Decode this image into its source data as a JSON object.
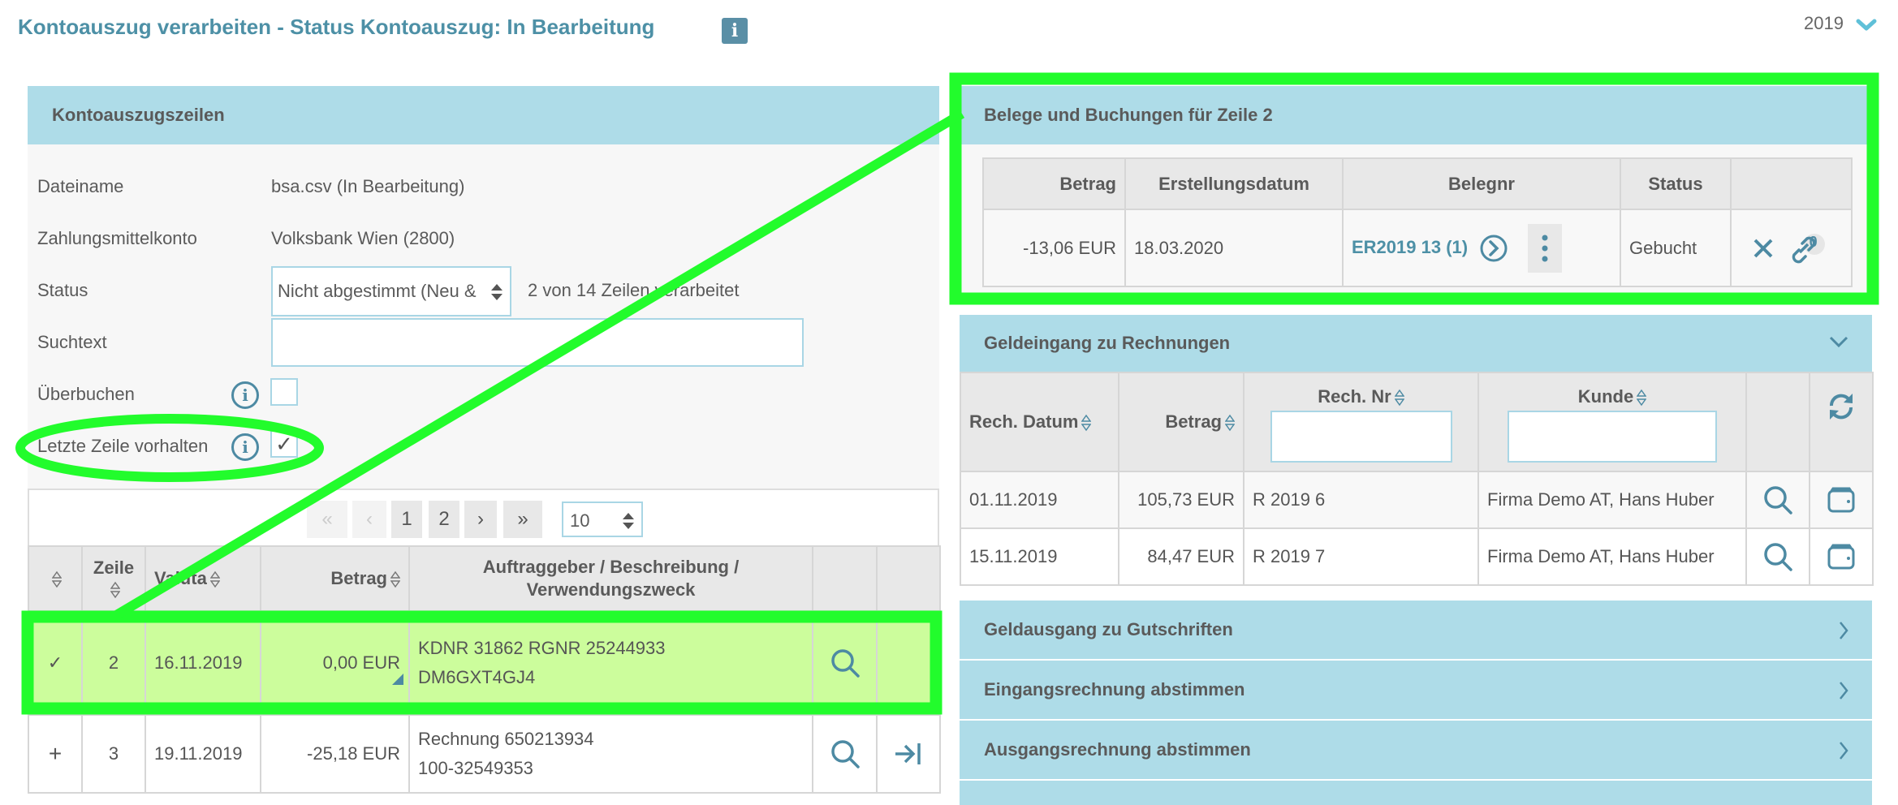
{
  "header": {
    "title": "Kontoauszug verarbeiten - Status Kontoauszug: In Bearbeitung",
    "info_icon_glyph": "i",
    "year": "2019"
  },
  "left_panel": {
    "title": "Kontoauszugszeilen",
    "form": {
      "dateiname_label": "Dateiname",
      "dateiname_value": "bsa.csv (In Bearbeitung)",
      "konto_label": "Zahlungsmittelkonto",
      "konto_value": "Volksbank Wien (2800)",
      "status_label": "Status",
      "status_selected": "Nicht abgestimmt (Neu &",
      "status_progress": "2 von 14 Zeilen verarbeitet",
      "suchtext_label": "Suchtext",
      "suchtext_value": "",
      "ueberbuchen_label": "Überbuchen",
      "ueberbuchen_checked": false,
      "letzte_zeile_label": "Letzte Zeile vorhalten",
      "letzte_zeile_checked": true,
      "check_glyph": "✓"
    },
    "pagination": {
      "first": "«",
      "prev": "‹",
      "pages": [
        "1",
        "2"
      ],
      "next": "›",
      "last": "»",
      "page_size": "10"
    },
    "table": {
      "columns": [
        "",
        "Zeile",
        "Valuta",
        "Betrag",
        "Auftraggeber / Beschreibung / Verwendungszweck",
        "",
        ""
      ],
      "rows": [
        {
          "marker": "✓",
          "zeile": "2",
          "valuta": "16.11.2019",
          "betrag": "0,00 EUR",
          "desc1": "KDNR 31862 RGNR 25244933",
          "desc2": "DM6GXT4GJ4",
          "highlighted": true
        },
        {
          "marker": "+",
          "zeile": "3",
          "valuta": "19.11.2019",
          "betrag": "-25,18 EUR",
          "desc1": "Rechnung 650213934",
          "desc2": "100-32549353",
          "highlighted": false
        }
      ]
    }
  },
  "belege_panel": {
    "title": "Belege und Buchungen für Zeile 2",
    "columns": [
      "Betrag",
      "Erstellungsdatum",
      "Belegnr",
      "Status",
      ""
    ],
    "rows": [
      {
        "betrag": "-13,06 EUR",
        "datum": "18.03.2020",
        "belegnr": "ER2019 13 (1)",
        "status": "Gebucht",
        "link_count": "0"
      }
    ]
  },
  "geldeingang_panel": {
    "title": "Geldeingang zu Rechnungen",
    "columns": [
      "Rech. Datum",
      "Betrag",
      "Rech. Nr",
      "Kunde",
      "",
      ""
    ],
    "filters": {
      "rech_nr": "",
      "kunde": ""
    },
    "rows": [
      {
        "datum": "01.11.2019",
        "betrag": "105,73 EUR",
        "rech_nr": "R 2019 6",
        "kunde": "Firma Demo AT, Hans Huber"
      },
      {
        "datum": "15.11.2019",
        "betrag": "84,47 EUR",
        "rech_nr": "R 2019 7",
        "kunde": "Firma Demo AT, Hans Huber"
      }
    ]
  },
  "collapsed_panels": [
    {
      "title": "Geldausgang zu Gutschriften"
    },
    {
      "title": "Eingangsrechnung abstimmen"
    },
    {
      "title": "Ausgangsrechnung abstimmen"
    },
    {
      "title": ""
    }
  ],
  "colors": {
    "accent": "#4d90a6",
    "panel_header": "#aedce8",
    "highlight_row": "#ccfd9c",
    "annotation": "#22fc2c"
  }
}
